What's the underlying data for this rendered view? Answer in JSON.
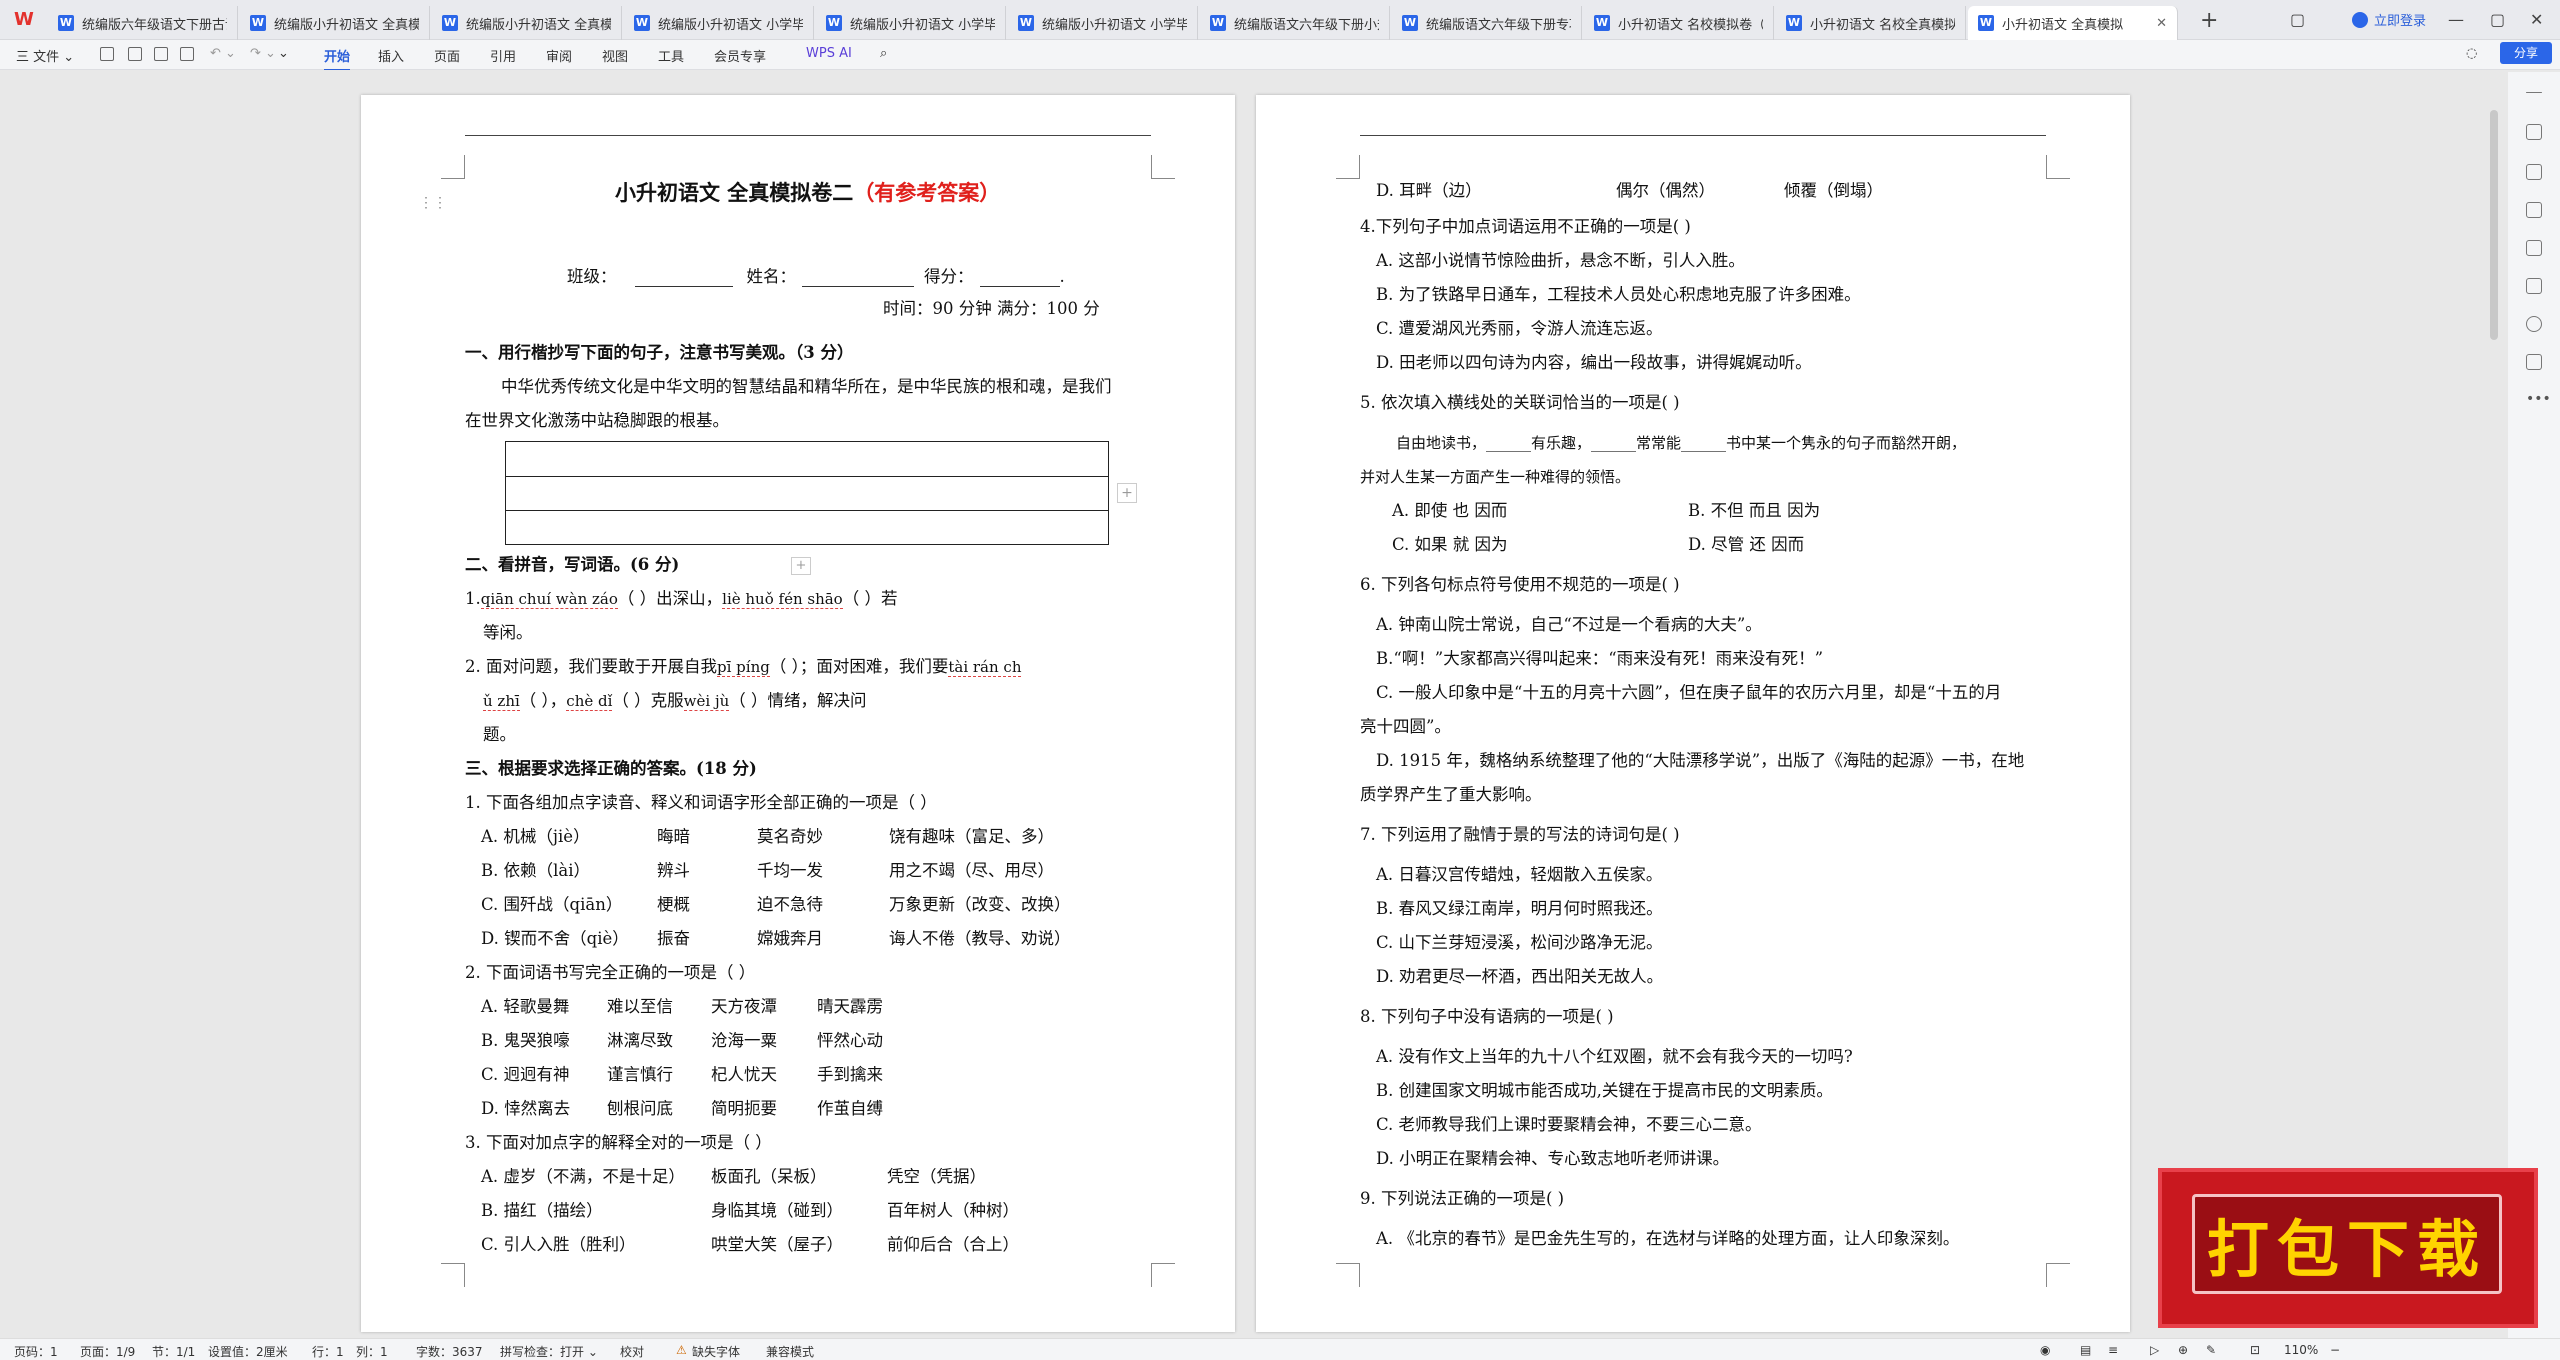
{
  "app": {
    "logo": "W"
  },
  "tabs": [
    "统编版六年级语文下册古诗",
    "统编版小升初语文 全真模拟",
    "统编版小升初语文 全真模拟",
    "统编版小升初语文 小学毕业",
    "统编版小升初语文 小学毕业",
    "统编版小升初语文 小学毕业",
    "统编版语文六年级下册小升",
    "统编版语文六年级下册专项",
    "小升初语文 名校模拟卷（含",
    "小升初语文 名校全真模拟卷",
    "小升初语文 全真模拟"
  ],
  "window": {
    "login": "立即登录",
    "share": "分享",
    "new_tab": "+",
    "close": "✕"
  },
  "toolbar": {
    "file": "三 文件 ⌄",
    "items": [
      "开始",
      "插入",
      "页面",
      "引用",
      "审阅",
      "视图",
      "工具",
      "会员专享"
    ],
    "ai": "WPS AI"
  },
  "page1": {
    "title_black": "小升初语文 全真模拟卷二",
    "title_red": "（有参考答案）",
    "class_label": "班级：",
    "name_label": "姓名：",
    "score_label": "得分：",
    "time": "时间：90 分钟    满分：100 分",
    "s1": "一、用行楷抄写下面的句子，注意书写美观。（3 分）",
    "s1_text1": "中华优秀传统文化是中华文明的智慧结晶和精华所在，是中华民族的根和魂，是我们",
    "s1_text2": "在世界文化激荡中站稳脚跟的根基。",
    "s2": "二、看拼音，写词语。(6 分)",
    "s2_q1a": "1.",
    "s2_q1_py": "qiān  chuí  wàn  záo",
    "s2_q1b": "（               ）出深山，",
    "s2_q1_py2": "liè  huǒ  fén  shāo",
    "s2_q1c": "（               ）若",
    "s2_q1d": "等闲。",
    "s2_q2a": "2. 面对问题，我们要敢于开展自我",
    "s2_q2_py": "pī  píng",
    "s2_q2b": "（          ）；面对困难，我们要",
    "s2_q2_py2": "tài  rán  ch",
    "s2_q2c_py": "ǔ  zhī",
    "s2_q2d": "（              ），",
    "s2_q2_py3": "chè  dǐ",
    "s2_q2e": "（          ）克服",
    "s2_q2_py4": "wèi  jù",
    "s2_q2f": "（          ）情绪，解决问",
    "s2_q2g": "题。",
    "s3": "三、根据要求选择正确的答案。(18 分)",
    "q1": "1. 下面各组加点字读音、释义和词语字形全部正确的一项是（      ）",
    "q1_opts": [
      [
        "A. 机械（jiè）",
        "晦暗",
        "莫名奇妙",
        "饶有趣味（富足、多）"
      ],
      [
        "B. 依赖（lài）",
        "辨斗",
        "千均一发",
        "用之不竭（尽、用尽）"
      ],
      [
        "C. 围歼战（qiān）",
        "梗概",
        "迫不急待",
        "万象更新（改变、改换）"
      ],
      [
        "D. 锲而不舍（qiè）",
        "振奋",
        "嫦娥奔月",
        "诲人不倦（教导、劝说）"
      ]
    ],
    "q2": "2. 下面词语书写完全正确的一项是（          ）",
    "q2_opts": [
      [
        "A. 轻歌曼舞",
        "难以至信",
        "天方夜潭",
        "晴天霹雳"
      ],
      [
        "B. 鬼哭狼嚎",
        "淋漓尽致",
        "沧海一粟",
        "怦然心动"
      ],
      [
        "C. 迥迥有神",
        "谨言慎行",
        "杞人忧天",
        "手到擒来"
      ],
      [
        "D. 悻然离去",
        "刨根问底",
        "简明扼要",
        "作茧自缚"
      ]
    ],
    "q3": "3. 下面对加点字的解释全对的一项是（          ）",
    "q3_opts": [
      [
        "A. 虚岁（不满，不是十足）",
        "板面孔（呆板）",
        "凭空（凭据）"
      ],
      [
        "B. 描红（描绘）",
        "身临其境（碰到）",
        "百年树人（种树）"
      ],
      [
        "C. 引人入胜（胜利）",
        "哄堂大笑（屋子）",
        "前仰后合（合上）"
      ]
    ]
  },
  "page2": {
    "l0": [
      "D. 耳畔（边）",
      "偶尔（偶然）",
      "倾覆（倒塌）"
    ],
    "q4": "4.下列句子中加点词语运用不正确的一项是(          )",
    "q4_opts": [
      "A. 这部小说情节惊险曲折，悬念不断，引人入胜。",
      "B. 为了铁路早日通车，工程技术人员处心积虑地克服了许多困难。",
      "C. 遭爱湖风光秀丽，令游人流连忘返。",
      "D. 田老师以四句诗为内容，编出一段故事，讲得娓娓动听。"
    ],
    "q5": "5. 依次填入横线处的关联词恰当的一项是(        )",
    "q5_text1": "自由地读书，______有乐趣，______常常能______书中某一个隽永的句子而豁然开朗，",
    "q5_text2": "并对人生某一方面产生一种难得的领悟。",
    "q5_opts": [
      [
        "A. 即使    也    因而",
        "B. 不但    而且    因为"
      ],
      [
        "C. 如果    就    因为",
        "D. 尽管    还    因而"
      ]
    ],
    "q6": "6. 下列各句标点符号使用不规范的一项是(        )",
    "q6_opts": [
      "A. 钟南山院士常说，自己“不过是一个看病的大夫”。",
      "B.“啊！”大家都高兴得叫起来：“雨来没有死！雨来没有死！”",
      "C. 一般人印象中是“十五的月亮十六圆”，但在庚子鼠年的农历六月里，却是“十五的月",
      "亮十四圆”。",
      "D. 1915 年，魏格纳系统整理了他的“大陆漂移学说”，出版了《海陆的起源》一书，在地",
      "质学界产生了重大影响。"
    ],
    "q7": "7. 下列运用了融情于景的写法的诗词句是(        )",
    "q7_opts": [
      "A. 日暮汉宫传蜡烛，轻烟散入五侯家。",
      "B. 春风又绿江南岸，明月何时照我还。",
      "C. 山下兰芽短浸溪，松间沙路净无泥。",
      "D. 劝君更尽一杯酒，西出阳关无故人。"
    ],
    "q8": "8. 下列句子中没有语病的一项是(        )",
    "q8_opts": [
      "A. 没有作文上当年的九十八个红双圈，就不会有我今天的一切吗?",
      "B. 创建国家文明城市能否成功,关键在于提高市民的文明素质。",
      "C. 老师教导我们上课时要聚精会神，不要三心二意。",
      "D. 小明正在聚精会神、专心致志地听老师讲课。"
    ],
    "q9": "9. 下列说法正确的一项是(        )",
    "q9_opts": [
      "A. 《北京的春节》是巴金先生写的，在选材与详略的处理方面，让人印象深刻。"
    ]
  },
  "banner": "打包下载",
  "statusbar": {
    "items": [
      "页码：1",
      "页面：1/9",
      "节：1/1",
      "设置值：2厘米",
      "行：1",
      "列：1",
      "字数：3637",
      "拼写检查：打开 ⌄",
      "校对",
      "缺失字体",
      "兼容模式"
    ],
    "zoom": "110%"
  }
}
